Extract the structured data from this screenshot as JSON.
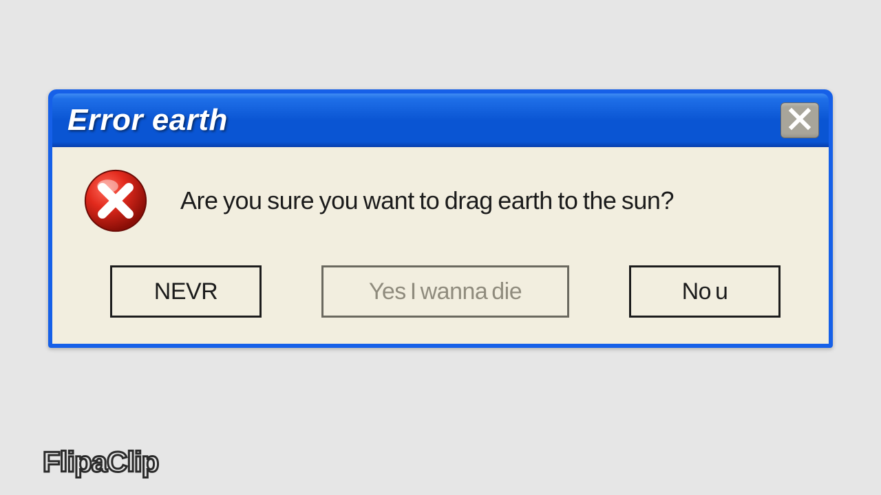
{
  "dialog": {
    "title": "Error earth",
    "message": "Are you sure you want to drag earth to the sun?",
    "buttons": {
      "nevr": "NEVR",
      "yes": "Yes I wanna die",
      "nou": "No u"
    }
  },
  "watermark": "FlipaClip",
  "colors": {
    "titlebar_blue": "#0a55d3",
    "body_beige": "#f2eedf",
    "page_grey": "#e6e6e6",
    "error_red": "#d02121"
  }
}
